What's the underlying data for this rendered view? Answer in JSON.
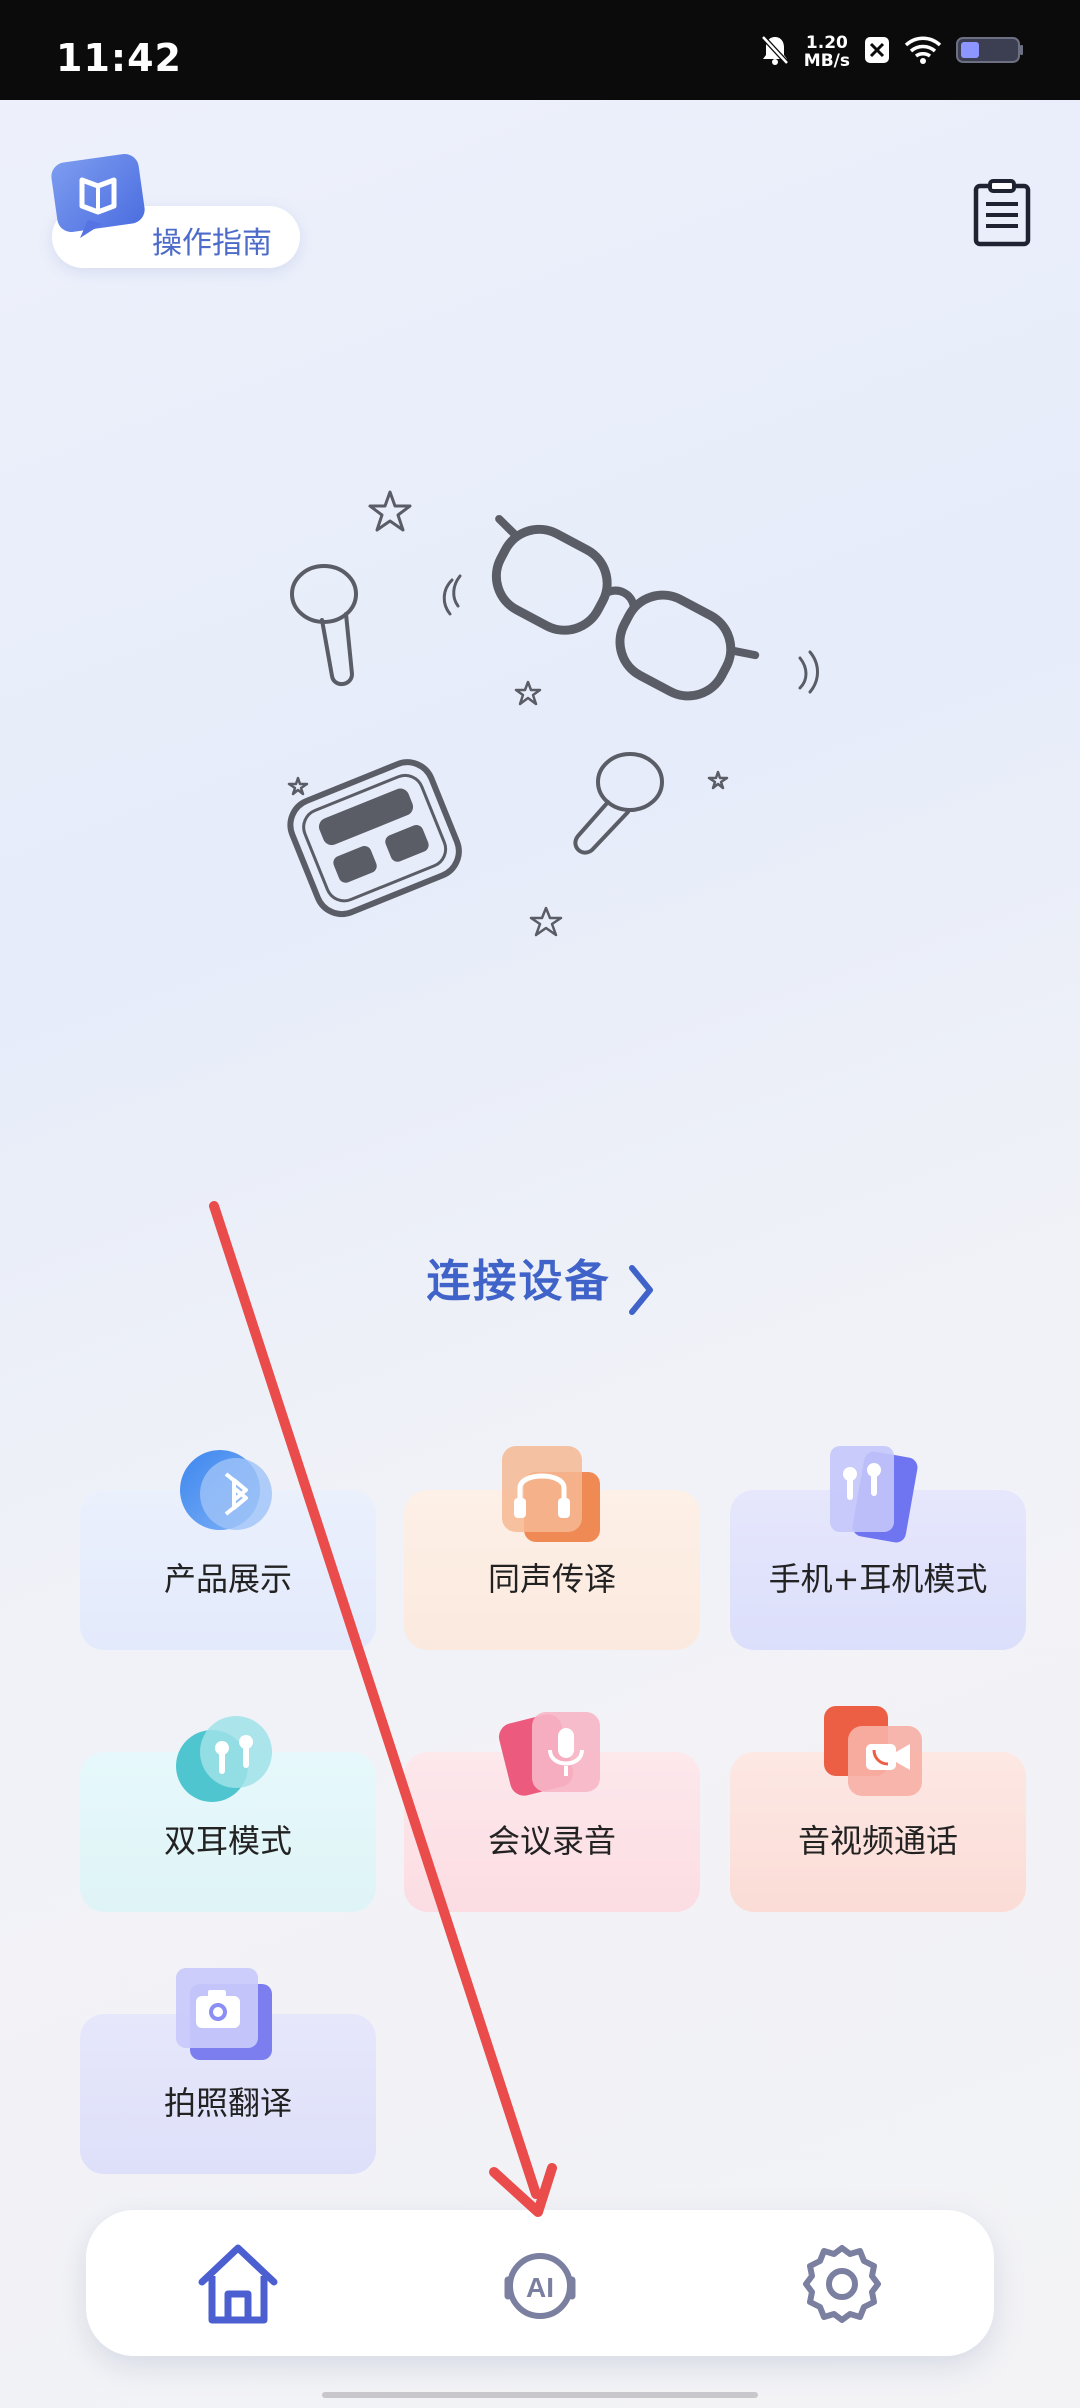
{
  "status_bar": {
    "time": "11:42",
    "speed_value": "1.20",
    "speed_unit": "MB/s",
    "icons": [
      "bell-muted-icon",
      "x-app-icon",
      "wifi-icon",
      "battery-icon"
    ]
  },
  "header": {
    "guide_label": "操作指南",
    "guide_icon": "book-chat-icon",
    "notes_icon": "clipboard-icon"
  },
  "hero": {
    "illustration": "glasses-earbuds-illustration"
  },
  "connect": {
    "label": "连接设备"
  },
  "features": [
    {
      "label": "产品展示",
      "icon": "bluetooth-icon"
    },
    {
      "label": "同声传译",
      "icon": "headset-icon"
    },
    {
      "label": "手机+耳机模式",
      "icon": "phone-earbuds-icon"
    },
    {
      "label": "双耳模式",
      "icon": "earbuds-icon"
    },
    {
      "label": "会议录音",
      "icon": "microphone-icon"
    },
    {
      "label": "音视频通话",
      "icon": "video-call-icon"
    },
    {
      "label": "拍照翻译",
      "icon": "camera-icon"
    }
  ],
  "bottom_nav": {
    "items": [
      {
        "name": "home",
        "icon": "home-icon",
        "active": true
      },
      {
        "name": "ai",
        "icon": "ai-assistant-icon",
        "active": false
      },
      {
        "name": "settings",
        "icon": "settings-icon",
        "active": false
      }
    ]
  },
  "colors": {
    "accent": "#3f63c8",
    "nav_active": "#4b5fd1",
    "nav_inactive": "#7b7fa0",
    "annotation_arrow": "#ea4b4b"
  }
}
